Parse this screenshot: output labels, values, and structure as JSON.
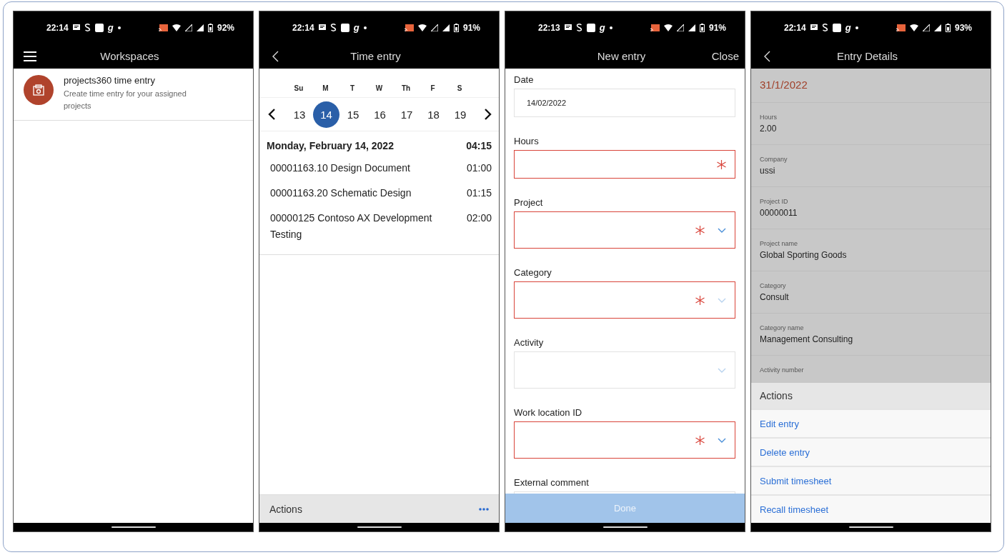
{
  "phones": [
    {
      "kind": "workspaces",
      "status": {
        "time": "22:14",
        "glyph": "g",
        "battery": "92%"
      },
      "header": {
        "title": "Workspaces",
        "menu": true
      },
      "workspaces": [
        {
          "title": "projects360 time entry",
          "description": "Create time entry for your assigned projects"
        }
      ]
    },
    {
      "kind": "time_entry",
      "status": {
        "time": "22:14",
        "glyph": "g",
        "battery": "91%"
      },
      "header": {
        "title": "Time entry",
        "back": true
      },
      "weekdays": [
        "Su",
        "M",
        "T",
        "W",
        "Th",
        "F",
        "S"
      ],
      "days": [
        {
          "label": "13",
          "selected": false
        },
        {
          "label": "14",
          "selected": true
        },
        {
          "label": "15",
          "selected": false
        },
        {
          "label": "16",
          "selected": false
        },
        {
          "label": "17",
          "selected": false
        },
        {
          "label": "18",
          "selected": false
        },
        {
          "label": "19",
          "selected": false
        }
      ],
      "date_heading": "Monday, February 14, 2022",
      "total": "04:15",
      "entries": [
        {
          "name": "00001163.10 Design Document",
          "hours": "01:00"
        },
        {
          "name": "00001163.20 Schematic Design",
          "hours": "01:15"
        },
        {
          "name": "00000125 Contoso AX Development Testing",
          "hours": "02:00"
        }
      ],
      "actions_bar": {
        "label": "Actions"
      }
    },
    {
      "kind": "new_entry",
      "status": {
        "time": "22:13",
        "glyph": "g",
        "battery": "91%"
      },
      "header": {
        "title": "New entry",
        "right": "Close"
      },
      "fields": [
        {
          "label": "Date",
          "value": "14/02/2022",
          "required": false,
          "dropdown": false
        },
        {
          "label": "Hours",
          "required": true,
          "dropdown": false
        },
        {
          "label": "Project",
          "required": true,
          "dropdown": true,
          "chevron_active": true
        },
        {
          "label": "Category",
          "required": true,
          "dropdown": true,
          "chevron_active": false
        },
        {
          "label": "Activity",
          "required": false,
          "dropdown": true,
          "chevron_active": false
        },
        {
          "label": "Work location ID",
          "required": true,
          "dropdown": true,
          "chevron_active": true
        },
        {
          "label": "External comment",
          "required": false,
          "dropdown": false
        }
      ],
      "done": "Done"
    },
    {
      "kind": "entry_details",
      "status": {
        "time": "22:14",
        "glyph": "g",
        "battery": "93%"
      },
      "header": {
        "title": "Entry Details",
        "back": true
      },
      "date": "31/1/2022",
      "details": [
        {
          "label": "Hours",
          "value": "2.00"
        },
        {
          "label": "Company",
          "value": "ussi"
        },
        {
          "label": "Project ID",
          "value": "00000011"
        },
        {
          "label": "Project name",
          "value": "Global Sporting Goods"
        },
        {
          "label": "Category",
          "value": "Consult"
        },
        {
          "label": "Category name",
          "value": "Management Consulting"
        },
        {
          "label": "Activity number"
        }
      ],
      "actions_title": "Actions",
      "actions": [
        "Edit entry",
        "Delete entry",
        "Submit timesheet",
        "Recall timesheet"
      ]
    }
  ]
}
